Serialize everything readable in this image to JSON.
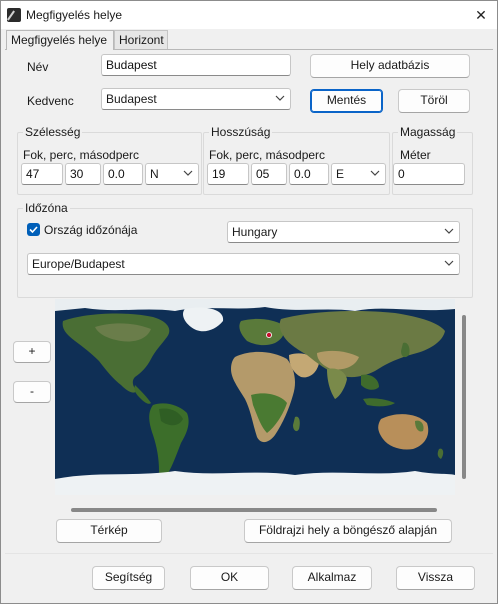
{
  "window": {
    "title": "Megfigyelés helye",
    "close_symbol": "✕"
  },
  "tabs": [
    {
      "label": "Megfigyelés helye",
      "active": true
    },
    {
      "label": "Horizont",
      "active": false
    }
  ],
  "name_row": {
    "label": "Név",
    "value": "Budapest",
    "db_button": "Hely adatbázis"
  },
  "favorite_row": {
    "label": "Kedvenc",
    "value": "Budapest",
    "save_button": "Mentés",
    "delete_button": "Töröl"
  },
  "latitude": {
    "title": "Szélesség",
    "sub_label": "Fok, perc, másodperc",
    "deg": "47",
    "min": "30",
    "sec": "0.0",
    "hemisphere": "N"
  },
  "longitude": {
    "title": "Hosszúság",
    "sub_label": "Fok, perc, másodperc",
    "deg": "19",
    "min": "05",
    "sec": "0.0",
    "hemisphere": "E"
  },
  "altitude": {
    "title": "Magasság",
    "unit_label": "Méter",
    "value": "0"
  },
  "timezone": {
    "title": "Időzóna",
    "country_checkbox_label": "Ország időzónája",
    "country_checked": true,
    "country": "Hungary",
    "zone": "Europe/Budapest"
  },
  "map": {
    "zoom_in": "+",
    "zoom_out": "-",
    "map_button": "Térkép",
    "browser_button": "Földrajzi hely a böngésző alapján"
  },
  "footer": {
    "help": "Segítség",
    "ok": "OK",
    "apply": "Alkalmaz",
    "back": "Vissza"
  },
  "colors": {
    "accent": "#005fb8",
    "ocean": "#0f2f55",
    "land_green": "#3f6b2c",
    "desert": "#b49a6a",
    "ice": "#eef2f4",
    "marker": "#c8102e"
  }
}
